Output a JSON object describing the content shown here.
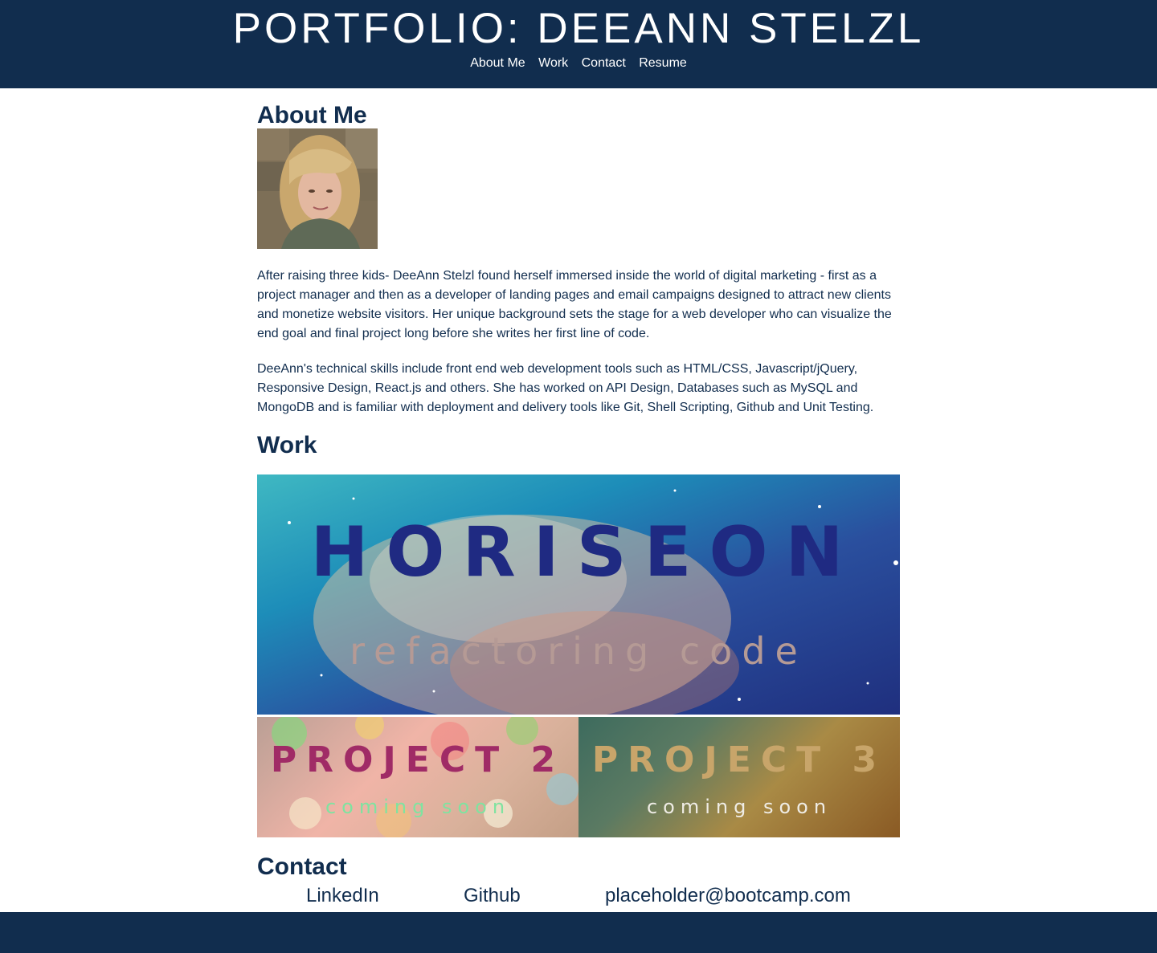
{
  "header": {
    "title": "PORTFOLIO: DEEANN STELZL",
    "nav": [
      "About Me",
      "Work",
      "Contact",
      "Resume"
    ]
  },
  "about": {
    "heading": "About Me",
    "paragraph_1": "After raising three kids- DeeAnn Stelzl found herself immersed inside the world of digital marketing - first as a project manager and then as a developer of landing pages and email campaigns designed to attract new clients and monetize website visitors. Her unique background sets the stage for a web developer who can visualize the end goal and final project long before she writes her first line of code.",
    "paragraph_2": "DeeAnn's technical skills include front end web development tools such as HTML/CSS, Javascript/jQuery, Responsive Design, React.js and others. She has worked on API Design, Databases such as MySQL and MongoDB and is familiar with deployment and delivery tools like Git, Shell Scripting, Github and Unit Testing."
  },
  "work": {
    "heading": "Work",
    "featured": {
      "title": "HORISEON",
      "subtitle": "refactoring code"
    },
    "projects": [
      {
        "title": "PROJECT 2",
        "subtitle": "coming soon"
      },
      {
        "title": "PROJECT 3",
        "subtitle": "coming soon"
      }
    ]
  },
  "contact": {
    "heading": "Contact",
    "linkedin": "LinkedIn",
    "github": "Github",
    "email": "placeholder@bootcamp.com"
  },
  "colors": {
    "brand_navy": "#112d4e",
    "background": "#ffffff"
  }
}
